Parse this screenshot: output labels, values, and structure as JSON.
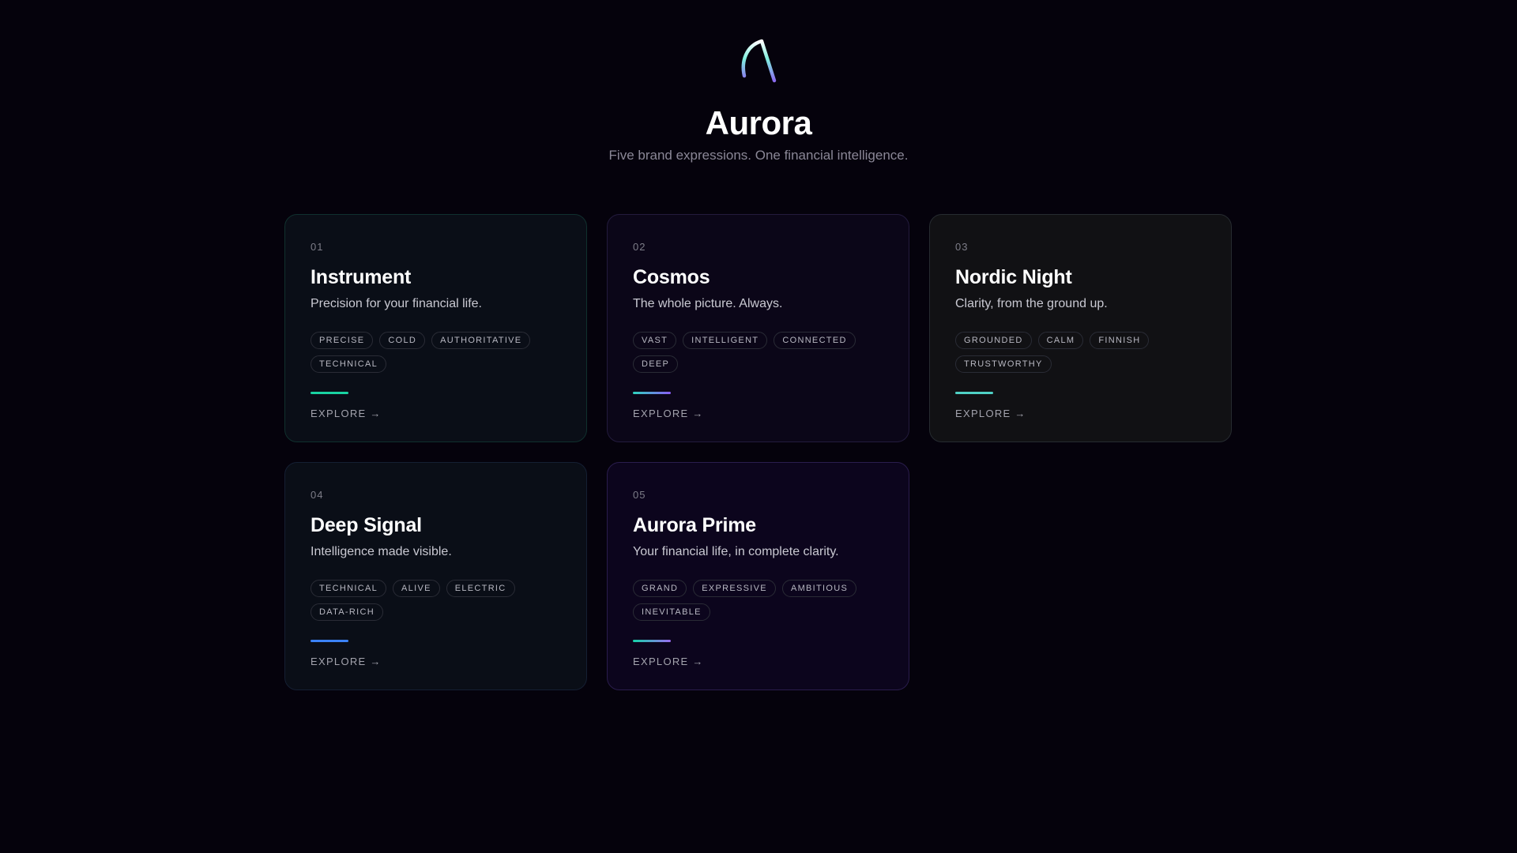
{
  "header": {
    "title": "Aurora",
    "subtitle": "Five brand expressions. One financial intelligence."
  },
  "cards": [
    {
      "number": "01",
      "title": "Instrument",
      "tagline": "Precision for your financial life.",
      "tags": [
        "PRECISE",
        "COLD",
        "AUTHORITATIVE",
        "TECHNICAL"
      ],
      "explore": "EXPLORE →",
      "bg": "#0a0e17",
      "border": "#10302e",
      "accent": "linear-gradient(90deg,#19d3a2,#19d3a2)"
    },
    {
      "number": "02",
      "title": "Cosmos",
      "tagline": "The whole picture. Always.",
      "tags": [
        "VAST",
        "INTELLIGENT",
        "CONNECTED",
        "DEEP"
      ],
      "explore": "EXPLORE →",
      "bg": "#0b0618",
      "border": "#231b3d",
      "accent": "linear-gradient(90deg,#2dd4bf,#8b5cf6)"
    },
    {
      "number": "03",
      "title": "Nordic Night",
      "tagline": "Clarity, from the ground up.",
      "tags": [
        "GROUNDED",
        "CALM",
        "FINNISH",
        "TRUSTWORTHY"
      ],
      "explore": "EXPLORE →",
      "bg": "#111114",
      "border": "#262b30",
      "accent": "linear-gradient(90deg,#4fd1c5,#4fd1c5)"
    },
    {
      "number": "04",
      "title": "Deep Signal",
      "tagline": "Intelligence made visible.",
      "tags": [
        "TECHNICAL",
        "ALIVE",
        "ELECTRIC",
        "DATA-RICH"
      ],
      "explore": "EXPLORE →",
      "bg": "#0a0e17",
      "border": "#151f33",
      "accent": "linear-gradient(90deg,#3b82f6,#3b82f6)"
    },
    {
      "number": "05",
      "title": "Aurora Prime",
      "tagline": "Your financial life, in complete clarity.",
      "tags": [
        "GRAND",
        "EXPRESSIVE",
        "AMBITIOUS",
        "INEVITABLE"
      ],
      "explore": "EXPLORE →",
      "bg": "#0c051d",
      "border": "#2a1d4d",
      "accent": "linear-gradient(90deg,#14d4a8,#9b6cf2)"
    }
  ]
}
